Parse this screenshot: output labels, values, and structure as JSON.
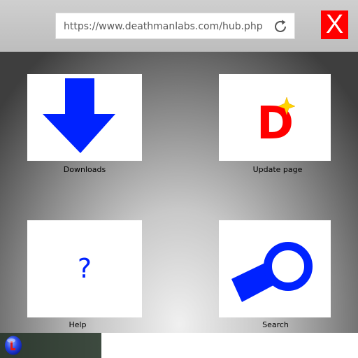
{
  "browser": {
    "url": "https://www.deathmanlabs.com/hub.php",
    "close_label": "X"
  },
  "tiles": {
    "downloads": {
      "label": "Downloads",
      "icon": "download-arrow-icon"
    },
    "update": {
      "label": "Update page",
      "icon": "d-sparkle-icon",
      "glyph": "D"
    },
    "help": {
      "label": "Help",
      "icon": "question-mark-icon",
      "glyph": "?"
    },
    "search": {
      "label": "Search",
      "icon": "magnifier-icon"
    }
  },
  "taskbar": {
    "start_icon": "orb-start-icon"
  },
  "colors": {
    "accent_blue": "#0022ff",
    "close_red": "#ff0000",
    "update_red": "#ff0000",
    "sparkle_yellow": "#ffd400"
  }
}
